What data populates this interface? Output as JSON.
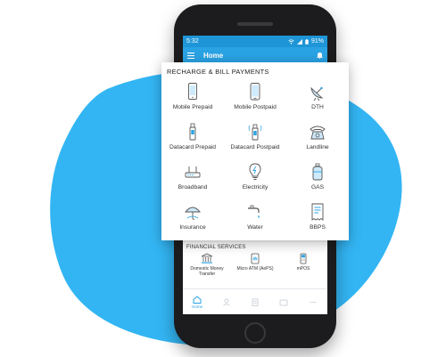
{
  "status_bar": {
    "time": "5:32",
    "battery": "91%"
  },
  "app_bar": {
    "title": "Home"
  },
  "recharge_section": {
    "heading": "RECHARGE & BILL PAYMENTS",
    "items": [
      {
        "label": "Mobile Prepaid",
        "icon": "mobile-prepaid-icon"
      },
      {
        "label": "Mobile Postpaid",
        "icon": "mobile-postpaid-icon"
      },
      {
        "label": "DTH",
        "icon": "satellite-dish-icon"
      },
      {
        "label": "Datacard Prepaid",
        "icon": "usb-datacard-icon"
      },
      {
        "label": "Datacard Postpaid",
        "icon": "usb-datacard-icon"
      },
      {
        "label": "Landline",
        "icon": "telephone-icon"
      },
      {
        "label": "Broadband",
        "icon": "router-icon"
      },
      {
        "label": "Electricity",
        "icon": "lightbulb-icon"
      },
      {
        "label": "GAS",
        "icon": "gas-cylinder-icon"
      },
      {
        "label": "Insurance",
        "icon": "umbrella-icon"
      },
      {
        "label": "Water",
        "icon": "water-tap-icon"
      },
      {
        "label": "BBPS",
        "icon": "bill-icon"
      }
    ]
  },
  "financial_section": {
    "heading": "FINANCIAL SERVICES",
    "items": [
      {
        "label": "Domestic Money Transfer",
        "icon": "bank-icon"
      },
      {
        "label": "Micro ATM (AePS)",
        "icon": "fingerprint-icon"
      },
      {
        "label": "mPOS",
        "icon": "pos-terminal-icon"
      }
    ]
  },
  "bottom_nav": {
    "home_label": "Home"
  },
  "colors": {
    "accent": "#2aa3e4",
    "status_bar": "#1e95d6",
    "blob": "#33b5f3"
  }
}
